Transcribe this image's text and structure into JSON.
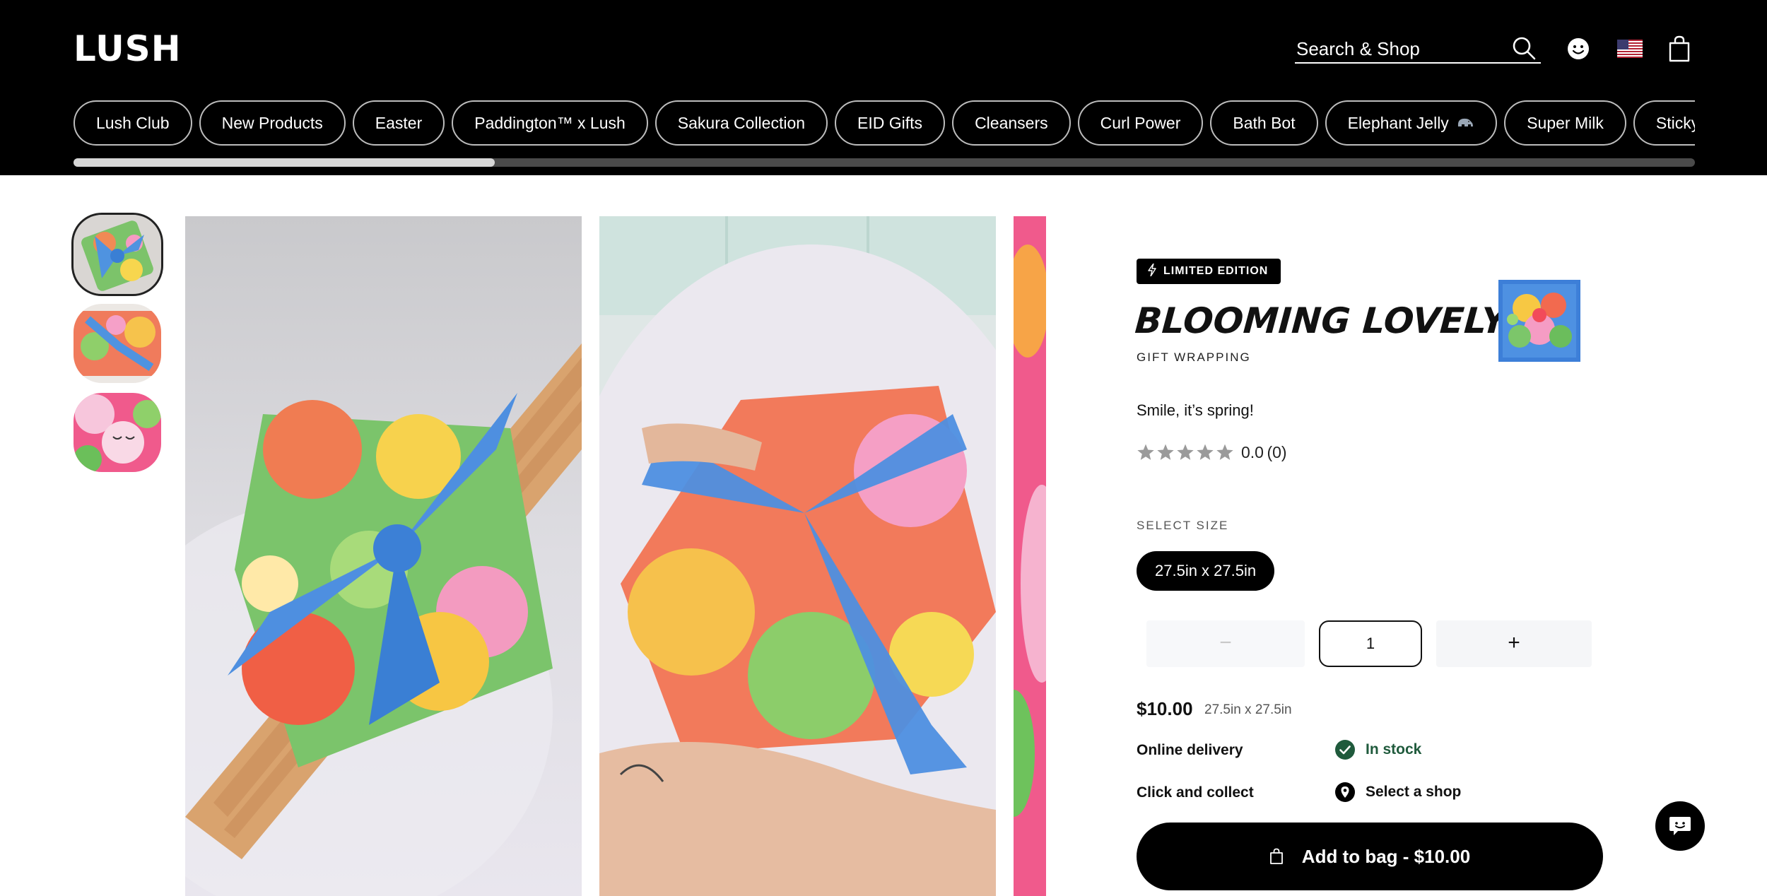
{
  "header": {
    "logo": "LUSH",
    "search_placeholder": "Search & Shop",
    "icons": {
      "search": "search-icon",
      "account": "smiley-account-icon",
      "region": "us-flag-icon",
      "bag": "shopping-bag-icon"
    },
    "categories": [
      {
        "label": "Lush Club"
      },
      {
        "label": "New Products"
      },
      {
        "label": "Easter"
      },
      {
        "label": "Paddington™ x Lush"
      },
      {
        "label": "Sakura Collection"
      },
      {
        "label": "EID Gifts"
      },
      {
        "label": "Cleansers"
      },
      {
        "label": "Curl Power"
      },
      {
        "label": "Bath Bot"
      },
      {
        "label": "Elephant Jelly",
        "icon": "elephant-icon"
      },
      {
        "label": "Super Milk"
      },
      {
        "label": "Sticky Dates"
      }
    ],
    "scroll_progress": 0.26
  },
  "product": {
    "badge": "LIMITED EDITION",
    "name": "BLOOMING LOVELY",
    "category": "GIFT WRAPPING",
    "tagline": "Smile, it’s spring!",
    "rating": {
      "value": "0.0",
      "count": "(0)",
      "stars": 0,
      "max_stars": 5
    },
    "size_label": "SELECT SIZE",
    "sizes": [
      {
        "label": "27.5in x 27.5in",
        "selected": true
      }
    ],
    "quantity": {
      "minus": "−",
      "value": "1",
      "plus": "+"
    },
    "price": "$10.00",
    "price_size": "27.5in x 27.5in",
    "delivery": {
      "label": "Online delivery",
      "status": "In stock"
    },
    "collect": {
      "label": "Click and collect",
      "status": "Select a shop"
    },
    "add_to_bag": "Add to bag - $10.00"
  },
  "colors": {
    "header_bg": "#000000",
    "instock_green": "#1f5a3c",
    "button_bg": "#000000"
  }
}
